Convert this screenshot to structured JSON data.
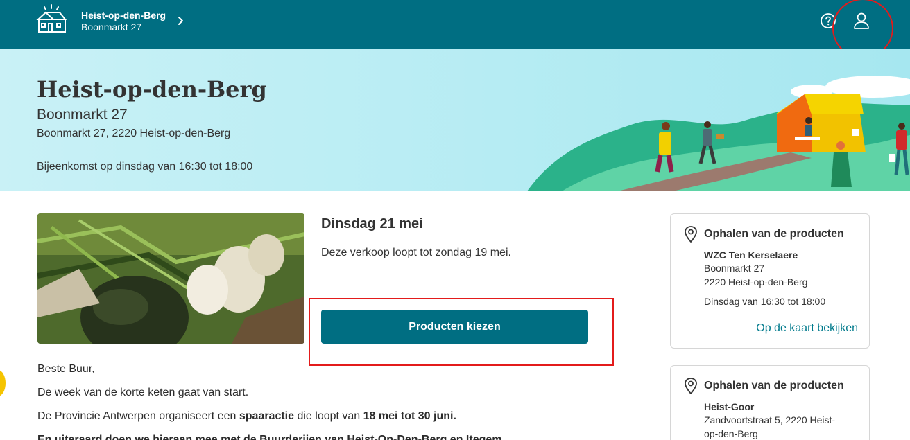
{
  "header": {
    "location_name": "Heist-op-den-Berg",
    "location_street": "Boonmarkt 27"
  },
  "hero": {
    "title": "Heist-op-den-Berg",
    "subtitle": "Boonmarkt 27",
    "address": "Boonmarkt 27, 2220 Heist-op-den-Berg",
    "meeting": "Bijeenkomst op dinsdag van 16:30 tot 18:00"
  },
  "sale": {
    "date": "Dinsdag 21 mei",
    "note": "Deze verkoop loopt tot zondag 19 mei.",
    "button_label": "Producten kiezen"
  },
  "body_text": {
    "greeting": "Beste Buur,",
    "line1": "De week van de korte keten gaat van start.",
    "line2_pre": "De Provincie Antwerpen organiseert een ",
    "line2_bold1": "spaaractie",
    "line2_mid": " die loopt van ",
    "line2_bold2": "18 mei tot 30 juni.",
    "line3": "En uiteraard doen we hieraan mee met de Buurderijen van Heist-Op-Den-Berg en Itegem"
  },
  "pickup_cards": [
    {
      "title": "Ophalen van de producten",
      "place": "WZC Ten Kerselaere",
      "street": "Boonmarkt 27",
      "city": "2220 Heist-op-den-Berg",
      "hours": "Dinsdag van 16:30 tot 18:00",
      "map_link": "Op de kaart bekijken"
    },
    {
      "title": "Ophalen van de producten",
      "place": "Heist-Goor",
      "address_line1": "Zandvoortstraat 5, 2220 Heist-",
      "address_line2": "op-den-Berg"
    }
  ],
  "colors": {
    "brand": "#006e82",
    "annotation": "#e31b1b",
    "link": "#007a8c"
  },
  "icons": [
    "home-logo-icon",
    "chevron-right-icon",
    "help-icon",
    "user-icon",
    "map-pin-icon"
  ]
}
